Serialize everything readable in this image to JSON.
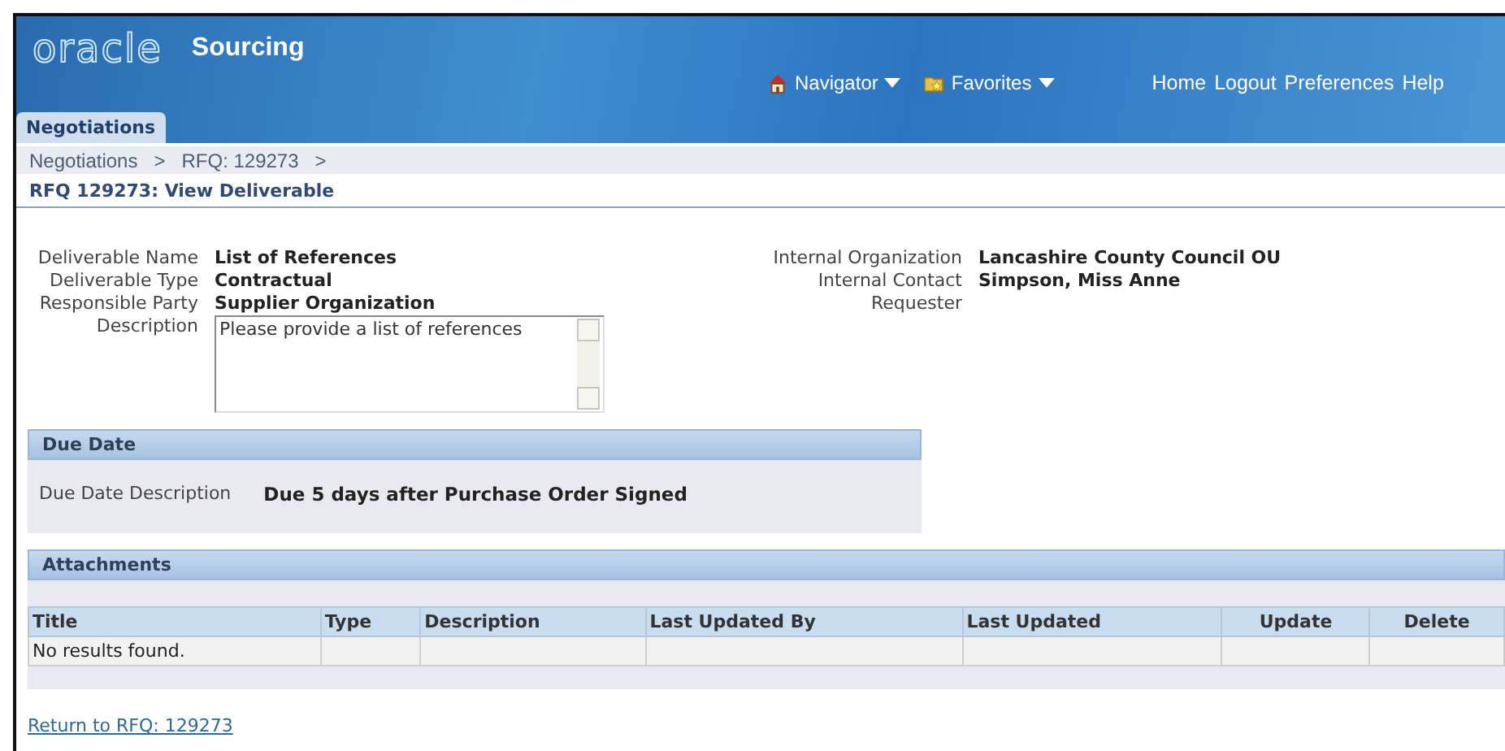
{
  "header": {
    "logo": "oracle",
    "product": "Sourcing",
    "global_menus": [
      {
        "label": "Navigator"
      },
      {
        "label": "Favorites"
      }
    ],
    "links": [
      "Home",
      "Logout",
      "Preferences",
      "Help"
    ]
  },
  "tabs": [
    {
      "label": "Negotiations",
      "selected": true
    }
  ],
  "breadcrumbs": [
    {
      "label": "Negotiations",
      "separator": ">"
    },
    {
      "label": "RFQ: 129273",
      "separator": ">"
    }
  ],
  "page_title": "RFQ 129273: View Deliverable",
  "left_fields": [
    {
      "label": "Deliverable Name",
      "value": "List of References"
    },
    {
      "label": "Deliverable Type",
      "value": "Contractual"
    },
    {
      "label": "Responsible Party",
      "value": "Supplier Organization"
    }
  ],
  "description": {
    "label": "Description",
    "value": "Please provide a list of references"
  },
  "right_fields": [
    {
      "label": "Internal Organization",
      "value": "Lancashire County Council OU"
    },
    {
      "label": "Internal Contact",
      "value": "Simpson, Miss Anne"
    },
    {
      "label": "Requester"
    }
  ],
  "due_date": {
    "heading": "Due Date",
    "label": "Due Date Description",
    "value": "Due 5 days after Purchase Order Signed"
  },
  "attachments": {
    "heading": "Attachments",
    "columns": [
      "Title",
      "Type",
      "Description",
      "Last Updated By",
      "Last Updated",
      "Update",
      "Delete"
    ],
    "empty_text": "No results found."
  },
  "return_link": "Return to RFQ: 129273"
}
